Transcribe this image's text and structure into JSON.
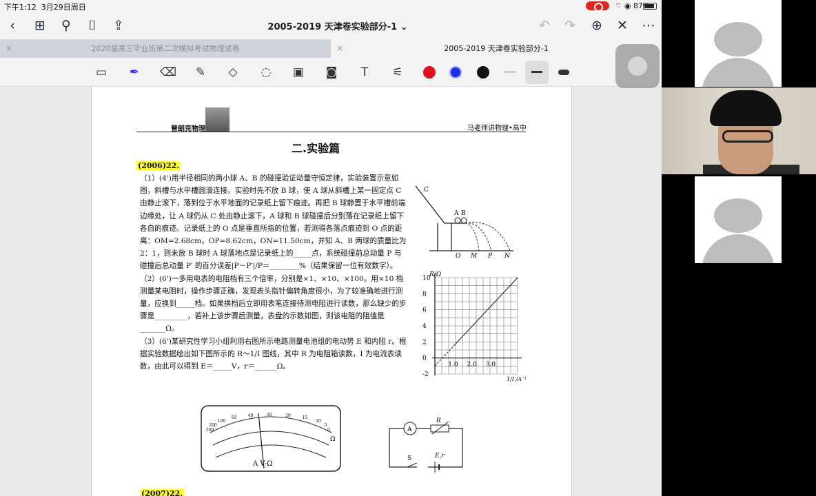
{
  "status": {
    "time": "下午1:12",
    "date": "3月29日周日",
    "battery": "87%"
  },
  "nav": {
    "title": "2005-2019 天津卷实验部分-1 ⌄"
  },
  "tabs": [
    {
      "label": "2020届高三毕业班第二次模拟考试物理试卷"
    },
    {
      "label": "2005-2019 天津卷实验部分-1"
    }
  ],
  "colors": {
    "red": "#e0101e",
    "blue": "#1a2fe6",
    "black": "#111111"
  },
  "icons": [
    "chevron-left-icon",
    "grid-icon",
    "search-icon",
    "bookmark-icon",
    "share-icon",
    "undo-icon",
    "redo-icon",
    "add-page-icon",
    "close-icon",
    "more-icon"
  ],
  "page": {
    "header_left": "普朗克物理",
    "header_right": "马老师讲物理•高中",
    "section_title": "二.实验篇",
    "year_2006": "(2006)22.",
    "year_2007": "(2007)22.",
    "paragraphs": [
      "（1）(4')用半径相同的两小球 A、B 的碰撞验证动量守恒定律，实验装置示意如图，斜槽与水平槽圆滑连接。实验时先不放 B 球，使 A 球从斜槽上某一固定点 C 由静止滚下，落到位于水平地面的记录纸上留下痕迹。再把 B 球静置于水平槽前端边缘处，让 A 球仍从 C 处由静止滚下，A 球和 B 球碰撞后分别落在记录纸上留下各自的痕迹。记录纸上的 O 点是垂直所指的位置，若测得各落点痕迹到 O 点的距离：OM=2.68cm，OP=8.62cm，ON=11.50cm，并知 A、B 两球的质量比为 2：1，则未放 B 球时 A 球落地点是记录纸上的_____点，系统碰撞前总动量 P 与碰撞后总动量 P′ 的百分误差|P－P′|/P＝________%（结果保留一位有效数字）。",
      "（2）(6')一多用电表的电阻档有三个倍率，分别是×1、×10、×100。用×10 档测量某电阻时，操作步骤正确，发现表头指针偏转角度很小，为了较准确地进行测量，应换到_____档。如果换档后立即用表笔连接待测电阻进行读数，那么缺少的步骤是_________，若补上该步骤后测量，表盘的示数如图，则该电阻的阻值是_______Ω。",
      "（3）(6')某研究性学习小组利用右图所示电路测量电池组的电动势 E 和内阻 r。根据实验数据绘出如下图所示的 R～1/I 图线，其中 R 为电阻箱读数，I 为电流表读数，由此可以得到 E＝_____V，r＝______Ω。"
    ],
    "fig_collision": {
      "labels": [
        "C",
        "A",
        "B",
        "O",
        "M",
        "P",
        "N"
      ]
    },
    "fig_meter": {
      "label": "A V-Ω",
      "scale_top": [
        "500",
        "200",
        "100",
        "50",
        "40",
        "30",
        "20",
        "15",
        "10",
        "5",
        "0"
      ],
      "omega": "Ω"
    },
    "fig_circuit": {
      "ammeter": "A",
      "resistor": "R",
      "switch": "S",
      "battery": "E,r"
    }
  },
  "chart_data": {
    "type": "line",
    "title": "",
    "xlabel": "1/I /A⁻¹",
    "ylabel": "R/Ω",
    "xlim": [
      0,
      4.4
    ],
    "ylim": [
      -2,
      10
    ],
    "x_ticks": [
      "1.0",
      "2.0",
      "3.0"
    ],
    "y_ticks": [
      "-2",
      "0",
      "2",
      "4",
      "6",
      "8",
      "10"
    ],
    "grid": true,
    "series": [
      {
        "x": [
          0,
          4.4
        ],
        "y": [
          -1.0,
          10.0
        ],
        "style": "solid-with-dashed-extension"
      }
    ]
  }
}
